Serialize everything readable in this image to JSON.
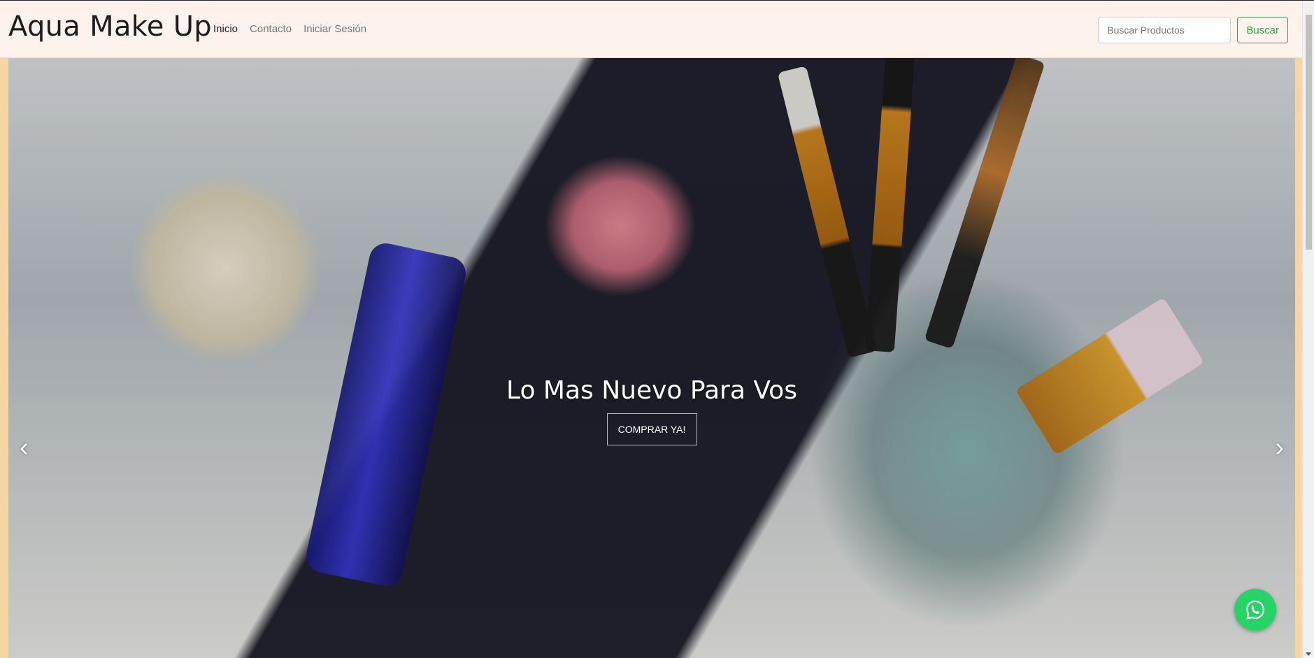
{
  "navbar": {
    "brand": "Aqua Make Up",
    "links": [
      {
        "label": "Inicio",
        "active": true
      },
      {
        "label": "Contacto",
        "active": false
      },
      {
        "label": "Iniciar Sesión",
        "active": false
      }
    ],
    "search": {
      "placeholder": "Buscar Productos",
      "button_label": "Buscar"
    }
  },
  "carousel": {
    "caption_title": "Lo Mas Nuevo Para Vos",
    "caption_button": "COMPRAR YA!",
    "prev_icon": "‹",
    "next_icon": "›"
  },
  "floating": {
    "whatsapp_icon": "whatsapp-icon"
  },
  "colors": {
    "navbar_bg": "#fdf3ec",
    "search_accent": "#28a745",
    "whatsapp": "#25d366",
    "page_side": "#f5d7a4"
  }
}
